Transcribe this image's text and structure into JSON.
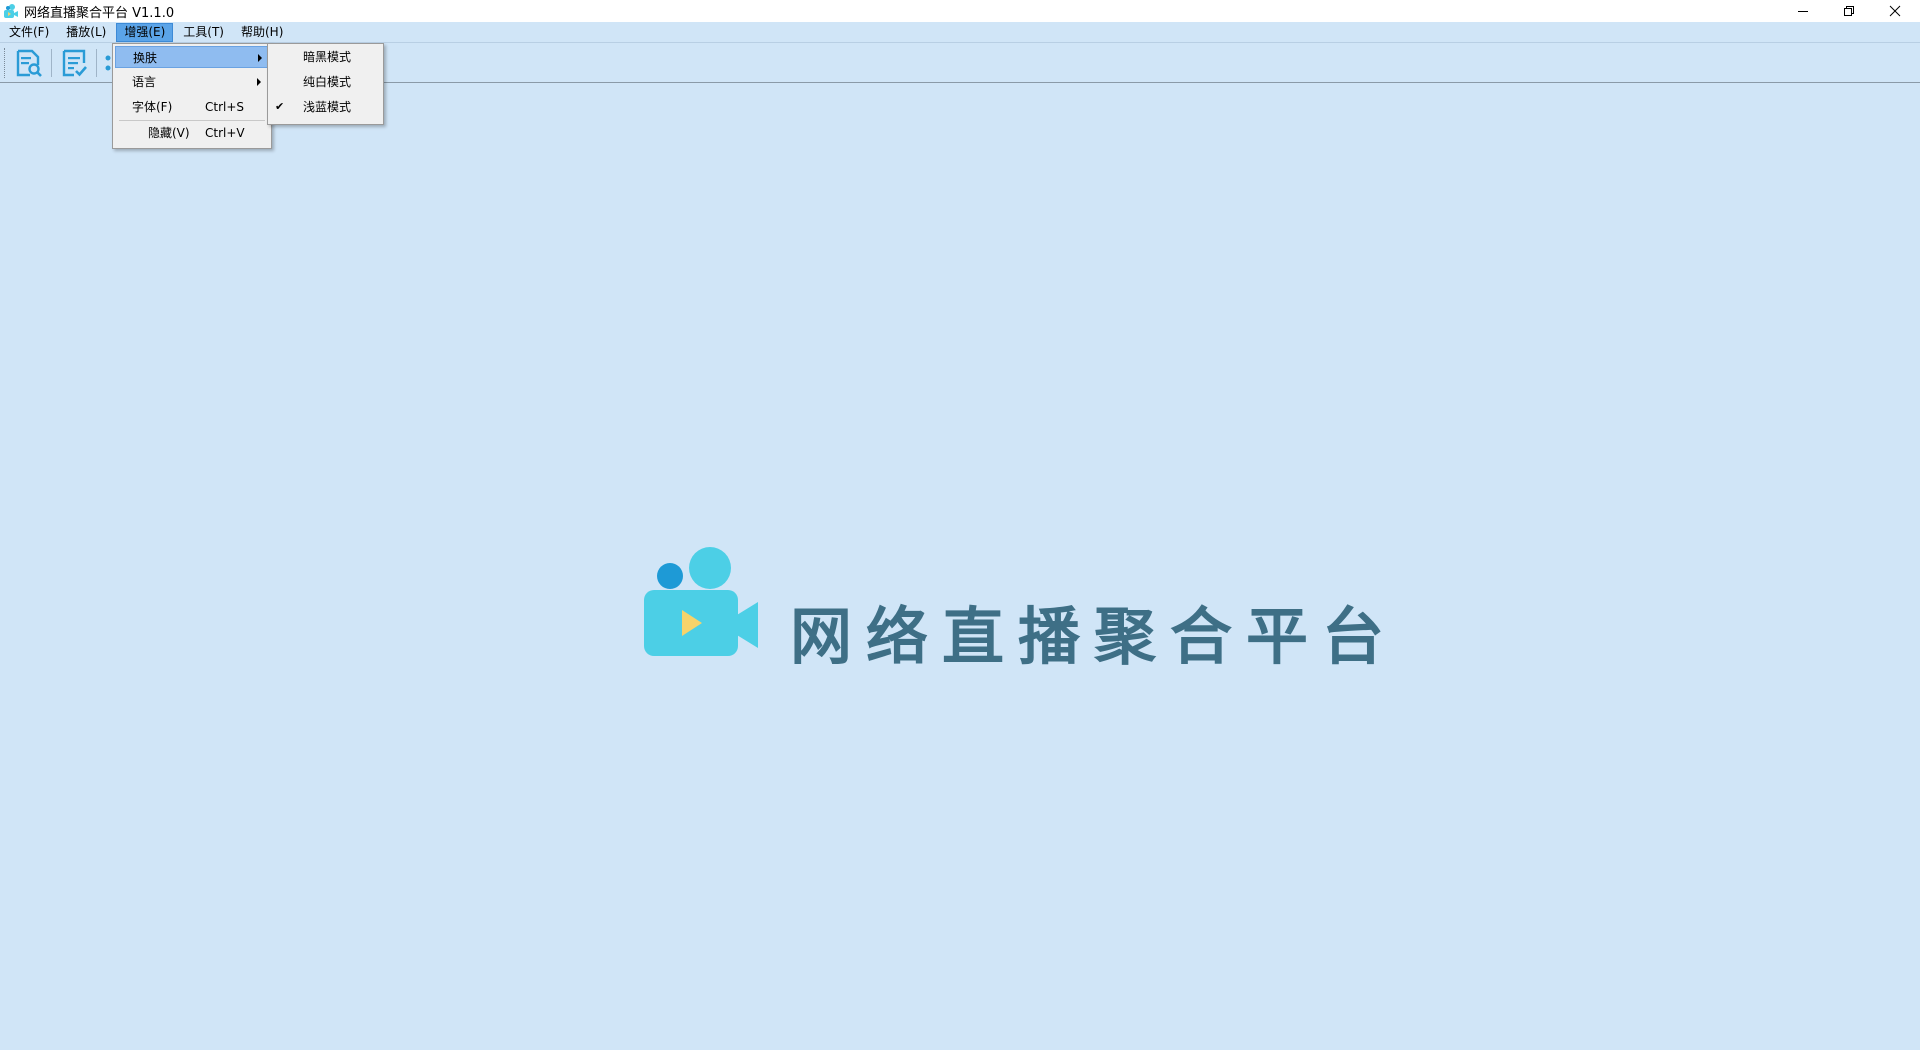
{
  "window": {
    "title": "网络直播聚合平台 V1.1.0"
  },
  "menubar": {
    "items": [
      {
        "label": "文件(F)"
      },
      {
        "label": "播放(L)"
      },
      {
        "label": "增强(E)"
      },
      {
        "label": "工具(T)"
      },
      {
        "label": "帮助(H)"
      }
    ]
  },
  "enhance_menu": {
    "skin": {
      "label": "换肤"
    },
    "language": {
      "label": "语言"
    },
    "font": {
      "label": "字体(F)",
      "shortcut": "Ctrl+S"
    },
    "hide": {
      "label": "隐藏(V)",
      "shortcut": "Ctrl+V"
    }
  },
  "skin_submenu": {
    "dark": {
      "label": "暗黑模式",
      "checked": false
    },
    "white": {
      "label": "纯白模式",
      "checked": false
    },
    "light_blue": {
      "label": "浅蓝模式",
      "checked": true
    },
    "check_glyph": "✔"
  },
  "toolbar": {
    "icons": [
      "search-document-icon",
      "checklist-icon",
      "partial-icon"
    ]
  },
  "logo": {
    "text": "网络直播聚合平台"
  },
  "colors": {
    "background": "#d0e5f7",
    "menu_active": "#5ba4e8",
    "menu_highlight": "#8fbcf0",
    "logo_text": "#3e6f86",
    "logo_cyan": "#4ccfe6",
    "logo_blue": "#1e9ad6",
    "logo_play": "#f6d36a"
  }
}
